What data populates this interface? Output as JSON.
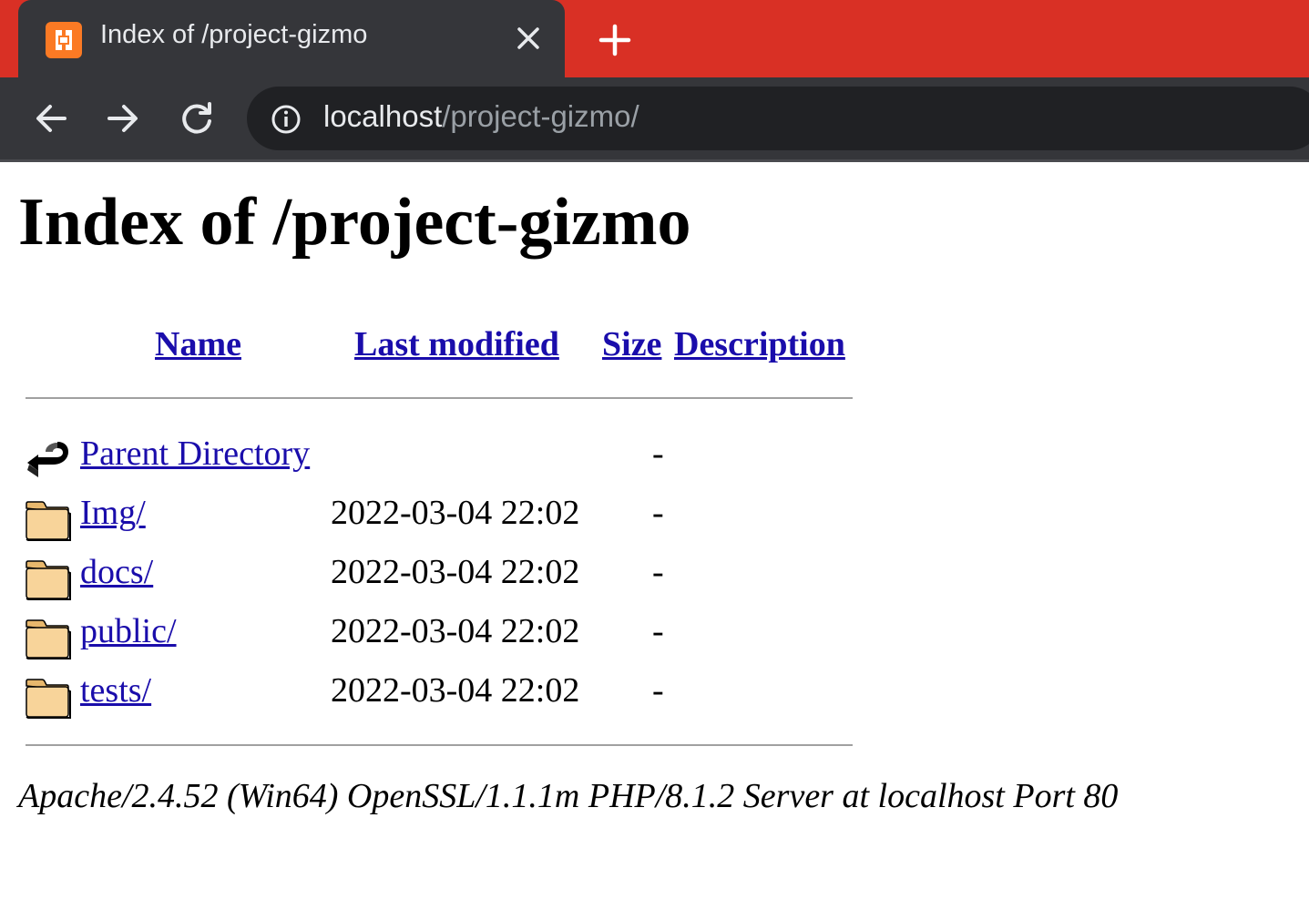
{
  "browser": {
    "tab_title": "Index of /project-gizmo",
    "url_host": "localhost",
    "url_path": "/project-gizmo/",
    "colors": {
      "tabstrip": "#d93025",
      "toolbar": "#35363a",
      "omnibox": "#202124",
      "favicon": "#fb7a24"
    },
    "icons": [
      "xampp-favicon-icon",
      "close-icon",
      "plus-icon",
      "arrow-left-icon",
      "arrow-right-icon",
      "reload-icon",
      "info-icon"
    ]
  },
  "page": {
    "title": "Index of /project-gizmo",
    "columns": {
      "name": "Name",
      "last_modified": "Last modified",
      "size": "Size",
      "description": "Description"
    },
    "entries": [
      {
        "name": "Parent Directory",
        "last_modified": "",
        "size": "-",
        "icon": "back-arrow-icon"
      },
      {
        "name": "Img/",
        "last_modified": "2022-03-04 22:02",
        "size": "-",
        "icon": "folder-icon"
      },
      {
        "name": "docs/",
        "last_modified": "2022-03-04 22:02",
        "size": "-",
        "icon": "folder-icon"
      },
      {
        "name": "public/",
        "last_modified": "2022-03-04 22:02",
        "size": "-",
        "icon": "folder-icon"
      },
      {
        "name": "tests/",
        "last_modified": "2022-03-04 22:02",
        "size": "-",
        "icon": "folder-icon"
      }
    ],
    "server_signature": "Apache/2.4.52 (Win64) OpenSSL/1.1.1m PHP/8.1.2 Server at localhost Port 80"
  }
}
